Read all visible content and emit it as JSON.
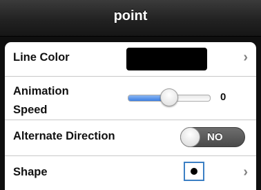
{
  "header": {
    "title": "point"
  },
  "settings": {
    "line_color": {
      "label": "Line Color",
      "color": "#000000"
    },
    "animation_speed": {
      "label_line1": "Animation",
      "label_line2": "Speed",
      "value": "0",
      "slider_fraction": 0.5
    },
    "alternate_direction": {
      "label": "Alternate Direction",
      "state_text": "NO"
    },
    "shape": {
      "label": "Shape",
      "selected": "filled-circle"
    }
  },
  "chevron_glyph": "›",
  "accent_colors": {
    "slider_fill": "#3b7ee3",
    "shape_border": "#3b7fc4"
  }
}
